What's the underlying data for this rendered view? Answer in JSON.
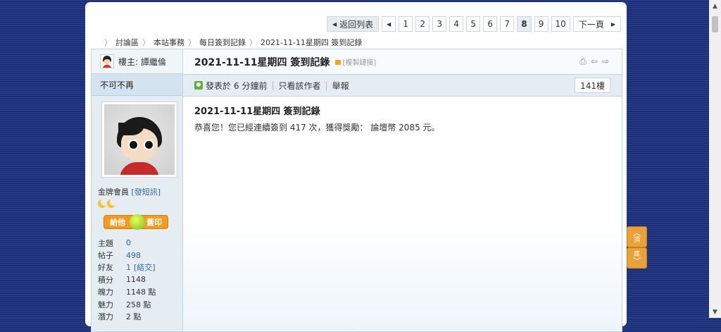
{
  "pagination": {
    "back_label": "返回列表",
    "pages": [
      "1",
      "2",
      "3",
      "4",
      "5",
      "6",
      "7",
      "8",
      "9",
      "10"
    ],
    "current": "8",
    "next_label": "下一頁"
  },
  "breadcrumb": [
    "討論區",
    "本站事務",
    "每日簽到記錄",
    "2021-11-11星期四 簽到記錄"
  ],
  "sidebar": {
    "owner_label": "樓主: 譚繼倫",
    "username": "不可不再",
    "group": "金牌會員",
    "pm_label": "[發短訊]",
    "stamp_left": "給他",
    "stamp_right": "蓋印",
    "stats": [
      {
        "key": "主題",
        "value": "0"
      },
      {
        "key": "帖子",
        "value": "498"
      },
      {
        "key": "好友",
        "value": "1",
        "extra": "[結交]"
      },
      {
        "key": "積分",
        "value": "1148"
      },
      {
        "key": "魄力",
        "value": "1148 點"
      },
      {
        "key": "魅力",
        "value": "258 點"
      },
      {
        "key": "潛力",
        "value": "2 點"
      }
    ]
  },
  "post": {
    "title": "2021-11-11星期四 簽到記錄",
    "copy_link": "[複製鏈接]",
    "posted_prefix": "發表於",
    "posted_time": "6 分鐘前",
    "author_only": "只看該作者",
    "report": "舉報",
    "floor": "141樓",
    "content_title": "2021-11-11星期四 簽到記錄",
    "content_body": "恭喜您！您已經連續簽到 417 次，獲得獎勵： 論壇幣 2085 元。"
  },
  "float": {
    "top_label": "頂",
    "bottom_label": "底"
  },
  "colors": {
    "background": "#1b2f7a",
    "accent": "#e9a23b",
    "border": "#c2d5e3"
  }
}
